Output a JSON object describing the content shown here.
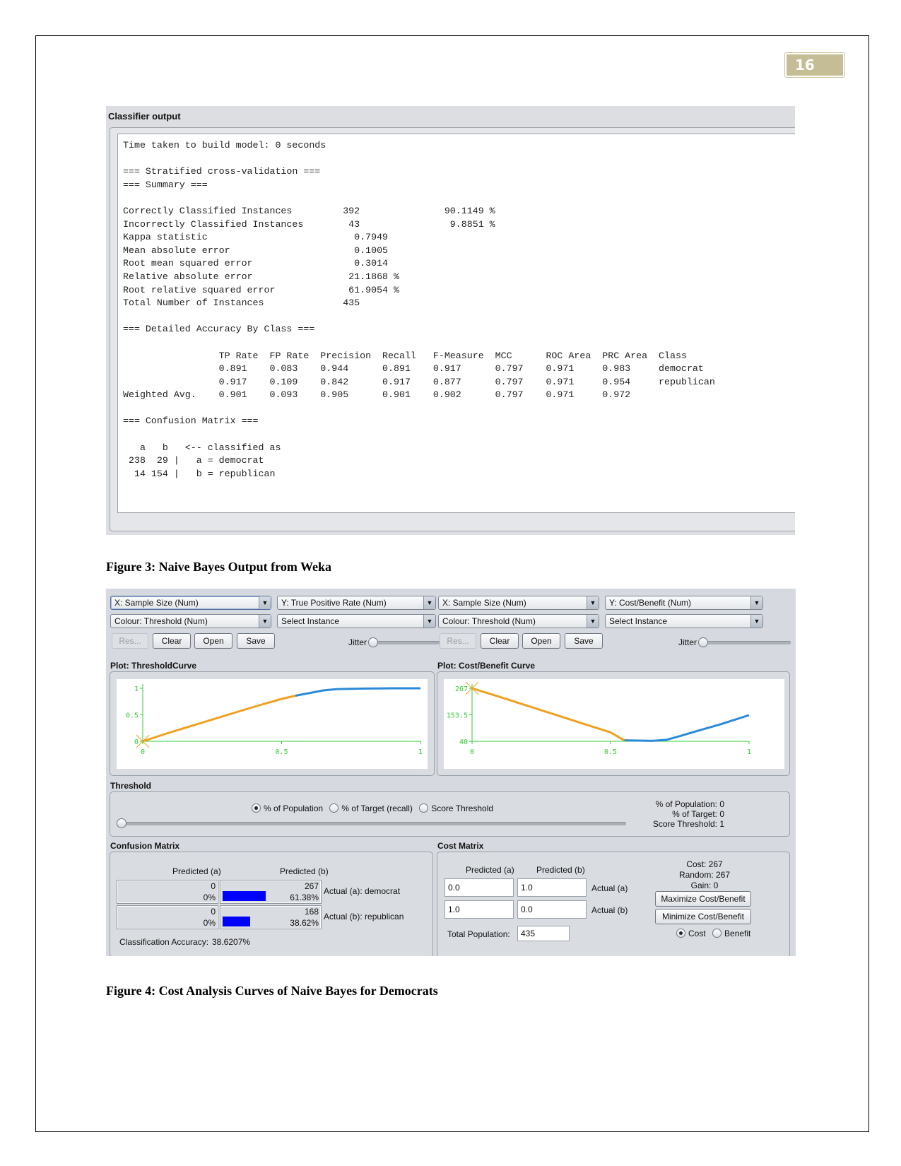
{
  "page": {
    "number": "16"
  },
  "figure3": {
    "panel_title": "Classifier output",
    "lines": [
      "Time taken to build model: 0 seconds",
      "",
      "=== Stratified cross-validation ===",
      "=== Summary ===",
      "",
      "Correctly Classified Instances         392               90.1149 %",
      "Incorrectly Classified Instances        43                9.8851 %",
      "Kappa statistic                          0.7949",
      "Mean absolute error                      0.1005",
      "Root mean squared error                  0.3014",
      "Relative absolute error                 21.1868 %",
      "Root relative squared error             61.9054 %",
      "Total Number of Instances              435",
      "",
      "=== Detailed Accuracy By Class ===",
      "",
      "                 TP Rate  FP Rate  Precision  Recall   F-Measure  MCC      ROC Area  PRC Area  Class",
      "                 0.891    0.083    0.944      0.891    0.917      0.797    0.971     0.983     democrat",
      "                 0.917    0.109    0.842      0.917    0.877      0.797    0.971     0.954     republican",
      "Weighted Avg.    0.901    0.093    0.905      0.901    0.902      0.797    0.971     0.972",
      "",
      "=== Confusion Matrix ===",
      "",
      "   a   b   <-- classified as",
      " 238  29 |   a = democrat",
      "  14 154 |   b = republican"
    ],
    "summary": {
      "time_taken": "0 seconds",
      "correctly_classified": {
        "count": 392,
        "percent": "90.1149 %"
      },
      "incorrectly_classified": {
        "count": 43,
        "percent": "9.8851 %"
      },
      "kappa": 0.7949,
      "mean_absolute_error": 0.1005,
      "root_mean_squared_error": 0.3014,
      "relative_absolute_error": "21.1868 %",
      "root_relative_squared_error": "61.9054 %",
      "total_instances": 435
    },
    "accuracy_by_class": {
      "columns": [
        "TP Rate",
        "FP Rate",
        "Precision",
        "Recall",
        "F-Measure",
        "MCC",
        "ROC Area",
        "PRC Area",
        "Class"
      ],
      "rows": [
        [
          "0.891",
          "0.083",
          "0.944",
          "0.891",
          "0.917",
          "0.797",
          "0.971",
          "0.983",
          "democrat"
        ],
        [
          "0.917",
          "0.109",
          "0.842",
          "0.917",
          "0.877",
          "0.797",
          "0.971",
          "0.954",
          "republican"
        ],
        [
          "0.901",
          "0.093",
          "0.905",
          "0.901",
          "0.902",
          "0.797",
          "0.971",
          "0.972",
          "Weighted Avg."
        ]
      ]
    },
    "confusion_matrix": {
      "a": [
        238,
        29
      ],
      "b": [
        14,
        154
      ],
      "labels": [
        "a = democrat",
        "b = republican"
      ]
    },
    "caption": "Figure 3: Naive Bayes Output from Weka"
  },
  "figure4": {
    "left": {
      "x_combo": "X: Sample Size (Num)",
      "y_combo": "Y: True Positive Rate (Num)",
      "colour_combo": "Colour: Threshold (Num)",
      "select_combo": "Select Instance",
      "buttons": {
        "reset": "Res...",
        "clear": "Clear",
        "open": "Open",
        "save": "Save"
      },
      "jitter_label": "Jitter",
      "plot_label": "Plot: ThresholdCurve"
    },
    "right": {
      "x_combo": "X: Sample Size (Num)",
      "y_combo": "Y: Cost/Benefit (Num)",
      "colour_combo": "Colour: Threshold (Num)",
      "select_combo": "Select Instance",
      "buttons": {
        "reset": "Res...",
        "clear": "Clear",
        "open": "Open",
        "save": "Save"
      },
      "jitter_label": "Jitter",
      "plot_label": "Plot: Cost/Benefit Curve"
    },
    "threshold": {
      "label": "Threshold",
      "options": [
        "% of Population",
        "% of Target (recall)",
        "Score Threshold"
      ],
      "selected": "% of Population",
      "slider_value": 0,
      "readout": {
        "population": "% of Population: 0",
        "target": "% of Target: 0",
        "score": "Score Threshold: 1"
      }
    },
    "confusion": {
      "label": "Confusion Matrix",
      "col_headers": [
        "Predicted (a)",
        "Predicted (b)"
      ],
      "rows": [
        {
          "actual": "Actual (a): democrat",
          "cells": [
            {
              "count": "0",
              "pct": "0%",
              "frac": 0
            },
            {
              "count": "267",
              "pct": "61.38%",
              "frac": 0.6138
            }
          ]
        },
        {
          "actual": "Actual (b): republican",
          "cells": [
            {
              "count": "0",
              "pct": "0%",
              "frac": 0
            },
            {
              "count": "168",
              "pct": "38.62%",
              "frac": 0.3862
            }
          ]
        }
      ],
      "accuracy_label": "Classification Accuracy:",
      "accuracy_value": "38.6207%"
    },
    "cost": {
      "label": "Cost Matrix",
      "col_headers": [
        "Predicted (a)",
        "Predicted (b)"
      ],
      "row_labels": [
        "Actual (a)",
        "Actual (b)"
      ],
      "values": [
        [
          "0.0",
          "1.0"
        ],
        [
          "1.0",
          "0.0"
        ]
      ],
      "total_population_label": "Total Population:",
      "total_population": "435",
      "cost_readout": "Cost: 267",
      "random_readout": "Random: 267",
      "gain_readout": "Gain: 0",
      "maximize_label": "Maximize Cost/Benefit",
      "minimize_label": "Minimize Cost/Benefit",
      "mode_options": [
        "Cost",
        "Benefit"
      ],
      "mode_selected": "Cost"
    },
    "caption": "Figure 4: Cost Analysis Curves of Naive Bayes for Democrats"
  },
  "chart_data": [
    {
      "type": "line",
      "title": "Plot: ThresholdCurve",
      "xlabel": "Sample Size",
      "ylabel": "True Positive Rate",
      "xlim": [
        0,
        1
      ],
      "ylim": [
        0,
        1
      ],
      "x_ticks": [
        "0",
        "0.5",
        "1"
      ],
      "y_ticks": [
        "0",
        "0.5",
        "1"
      ],
      "colour_by": "Threshold",
      "series": [
        {
          "name": "low-threshold (orange)",
          "color": "#f0a020",
          "x": [
            0,
            0.1,
            0.2,
            0.3,
            0.4,
            0.5,
            0.55
          ],
          "y": [
            0,
            0.17,
            0.33,
            0.49,
            0.65,
            0.8,
            0.86
          ]
        },
        {
          "name": "high-threshold (blue)",
          "color": "#2a8ad8",
          "x": [
            0.55,
            0.6,
            0.65,
            0.7,
            0.8,
            0.9,
            1.0
          ],
          "y": [
            0.86,
            0.91,
            0.96,
            0.985,
            0.995,
            1.0,
            1.0
          ]
        }
      ],
      "marker": {
        "x": 0,
        "y": 0
      }
    },
    {
      "type": "line",
      "title": "Plot: Cost/Benefit Curve",
      "xlabel": "Sample Size",
      "ylabel": "Cost/Benefit",
      "xlim": [
        0,
        1
      ],
      "ylim": [
        40,
        267
      ],
      "x_ticks": [
        "0",
        "0.5",
        "1"
      ],
      "y_ticks": [
        "40",
        "153.5",
        "267"
      ],
      "colour_by": "Threshold",
      "series": [
        {
          "name": "low-threshold (orange)",
          "color": "#f0a020",
          "x": [
            0,
            0.1,
            0.2,
            0.3,
            0.4,
            0.5,
            0.55
          ],
          "y": [
            267,
            230,
            192,
            154,
            116,
            78,
            44
          ]
        },
        {
          "name": "high-threshold (blue)",
          "color": "#2a8ad8",
          "x": [
            0.55,
            0.6,
            0.65,
            0.7,
            0.75,
            0.8,
            0.9,
            1.0
          ],
          "y": [
            44,
            43,
            42,
            46,
            62,
            80,
            114,
            152
          ]
        }
      ],
      "marker": {
        "x": 0,
        "y": 267
      }
    }
  ]
}
